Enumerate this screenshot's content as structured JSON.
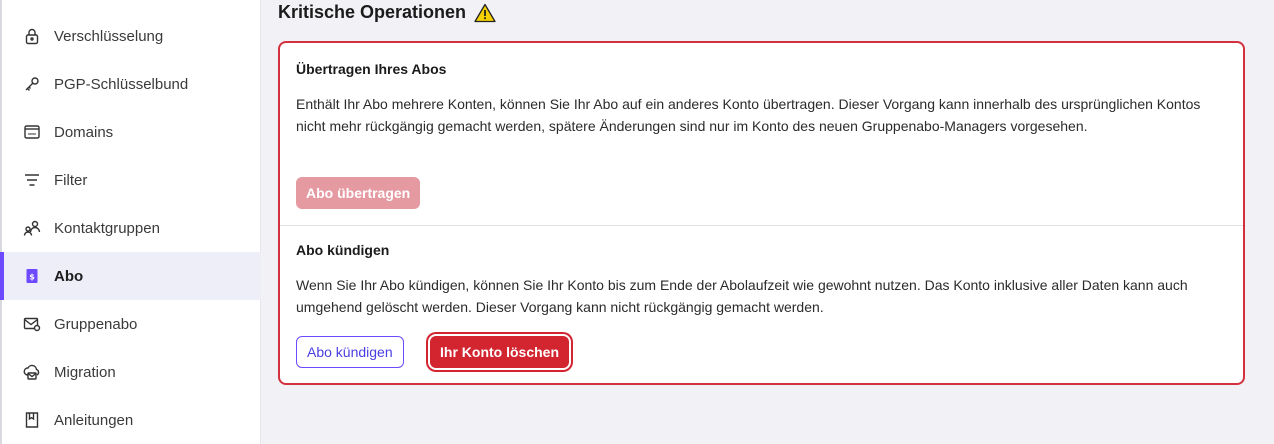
{
  "sidebar": {
    "items": [
      {
        "label": "Verschlüsselung",
        "icon": "lock-icon",
        "active": false
      },
      {
        "label": "PGP-Schlüsselbund",
        "icon": "key-icon",
        "active": false
      },
      {
        "label": "Domains",
        "icon": "domain-icon",
        "active": false
      },
      {
        "label": "Filter",
        "icon": "filter-icon",
        "active": false
      },
      {
        "label": "Kontaktgruppen",
        "icon": "contact-groups-icon",
        "active": false
      },
      {
        "label": "Abo",
        "icon": "subscription-icon",
        "active": true
      },
      {
        "label": "Gruppenabo",
        "icon": "group-mail-icon",
        "active": false
      },
      {
        "label": "Migration",
        "icon": "migration-icon",
        "active": false
      },
      {
        "label": "Anleitungen",
        "icon": "book-icon",
        "active": false
      }
    ],
    "accent_color": "#6d4aff"
  },
  "main": {
    "section_title": "Kritische Operationen",
    "section_icon": "warning-icon",
    "transfer": {
      "heading": "Übertragen Ihres Abos",
      "text": "Enthält Ihr Abo mehrere Konten, können Sie Ihr Abo auf ein anderes Konto übertragen. Dieser Vorgang kann innerhalb des ursprünglichen Kontos nicht mehr rückgängig gemacht werden, spätere Änderungen sind nur im Konto des neuen Gruppenabo-Managers vorgesehen.",
      "button_label": "Abo übertragen"
    },
    "cancel": {
      "heading": "Abo kündigen",
      "text": "Wenn Sie Ihr Abo kündigen, können Sie Ihr Konto bis zum Ende der Abolaufzeit wie gewohnt nutzen. Das Konto inklusive aller Daten kann auch umgehend gelöscht werden. Dieser Vorgang kann nicht rückgängig gemacht werden.",
      "cancel_button_label": "Abo kündigen",
      "delete_button_label": "Ihr Konto löschen"
    },
    "danger_color": "#d2252f"
  }
}
